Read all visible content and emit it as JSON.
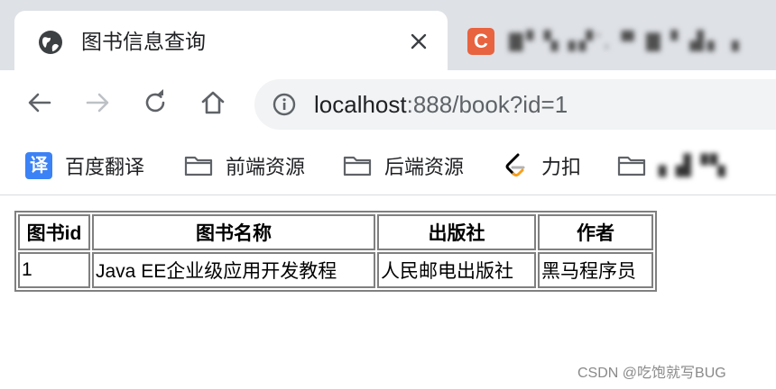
{
  "browser": {
    "active_tab": {
      "title": "图书信息查询",
      "favicon": "globe-icon",
      "close_icon": "close-icon"
    },
    "other_tab": {
      "favicon_letter": "C",
      "favicon_color": "#e8633f",
      "title": "▇▘▚▗▞ʼ, ▀ ▇▝ ▟▖▗"
    },
    "toolbar": {
      "back": "back-arrow-icon",
      "forward": "forward-arrow-icon",
      "reload": "reload-icon",
      "home": "home-icon"
    },
    "address_bar": {
      "host": "localhost",
      "path": ":888/book?id=1",
      "security_icon": "info-icon"
    },
    "bookmarks": [
      {
        "label": "百度翻译",
        "icon": "translate-icon",
        "icon_glyph": "译"
      },
      {
        "label": "前端资源",
        "icon": "folder-icon"
      },
      {
        "label": "后端资源",
        "icon": "folder-icon"
      },
      {
        "label": "力扣",
        "icon": "leetcode-icon"
      },
      {
        "label": "▖▟▝▚",
        "icon": "folder-icon"
      }
    ]
  },
  "page": {
    "table": {
      "headers": [
        "图书id",
        "图书名称",
        "出版社",
        "作者"
      ],
      "rows": [
        [
          "1",
          "Java EE企业级应用开发教程",
          "人民邮电出版社",
          "黑马程序员"
        ]
      ]
    },
    "watermark": "CSDN @吃饱就写BUG"
  }
}
